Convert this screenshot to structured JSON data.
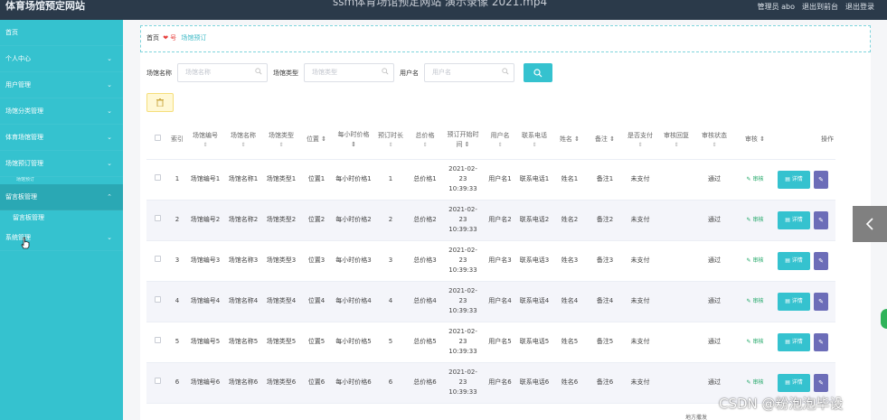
{
  "topbar": {
    "site_title": "体育场馆预定网站",
    "video_title": "ssm体育场馆预定网站 演示录像 2021.mp4",
    "admin_label": "管理员 abo",
    "exit_to_front": "退出到前台",
    "logout": "退出登录"
  },
  "sidebar": {
    "items": [
      {
        "label": "首页",
        "has_chevron": false
      },
      {
        "label": "个人中心",
        "has_chevron": true
      },
      {
        "label": "用户管理",
        "has_chevron": true
      },
      {
        "label": "场馆分类管理",
        "has_chevron": true
      },
      {
        "label": "体育场馆管理",
        "has_chevron": true
      },
      {
        "label": "场馆预订管理",
        "has_chevron": true
      }
    ],
    "partial_sub": "场馆预订",
    "active": {
      "label": "留言板管理"
    },
    "active_sub": "留言板管理",
    "after": {
      "label": "系统管理"
    }
  },
  "breadcrumb": {
    "home": "首页",
    "heart": "❤",
    "sep": "号",
    "current": "场馆预订"
  },
  "search": {
    "venue_name_label": "场馆名称",
    "venue_name_placeholder": "场馆名称",
    "venue_type_label": "场馆类型",
    "venue_type_placeholder": "场馆类型",
    "user_label": "用户名",
    "user_placeholder": "用户名"
  },
  "table": {
    "headers": [
      "索引",
      "场馆编号",
      "场馆名称",
      "场馆类型",
      "位置",
      "每小时价格",
      "预订时长",
      "总价格",
      "预订开始时间",
      "用户名",
      "联系电话",
      "姓名",
      "备注",
      "是否支付",
      "审核回复",
      "审核状态",
      "审核",
      "操作"
    ],
    "sort_mark": "⇕",
    "rows": [
      {
        "index": "1",
        "venue_no": "场馆编号1",
        "venue_name": "场馆名称1",
        "venue_type": "场馆类型1",
        "location": "位置1",
        "price": "每小时价格1",
        "duration": "1",
        "total": "总价格1",
        "start_time": "2021-02-23 10:39:33",
        "user": "用户名1",
        "phone": "联系电话1",
        "name": "姓名1",
        "remark": "备注1",
        "paid": "未支付",
        "reply": "",
        "status": "通过",
        "audit": "审核",
        "detail": "详情"
      },
      {
        "index": "2",
        "venue_no": "场馆编号2",
        "venue_name": "场馆名称2",
        "venue_type": "场馆类型2",
        "location": "位置2",
        "price": "每小时价格2",
        "duration": "2",
        "total": "总价格2",
        "start_time": "2021-02-23 10:39:33",
        "user": "用户名2",
        "phone": "联系电话2",
        "name": "姓名2",
        "remark": "备注2",
        "paid": "未支付",
        "reply": "",
        "status": "通过",
        "audit": "审核",
        "detail": "详情"
      },
      {
        "index": "3",
        "venue_no": "场馆编号3",
        "venue_name": "场馆名称3",
        "venue_type": "场馆类型3",
        "location": "位置3",
        "price": "每小时价格3",
        "duration": "3",
        "total": "总价格3",
        "start_time": "2021-02-23 10:39:33",
        "user": "用户名3",
        "phone": "联系电话3",
        "name": "姓名3",
        "remark": "备注3",
        "paid": "未支付",
        "reply": "",
        "status": "通过",
        "audit": "审核",
        "detail": "详情"
      },
      {
        "index": "4",
        "venue_no": "场馆编号4",
        "venue_name": "场馆名称4",
        "venue_type": "场馆类型4",
        "location": "位置4",
        "price": "每小时价格4",
        "duration": "4",
        "total": "总价格4",
        "start_time": "2021-02-23 10:39:33",
        "user": "用户名4",
        "phone": "联系电话4",
        "name": "姓名4",
        "remark": "备注4",
        "paid": "未支付",
        "reply": "",
        "status": "通过",
        "audit": "审核",
        "detail": "详情"
      },
      {
        "index": "5",
        "venue_no": "场馆编号5",
        "venue_name": "场馆名称5",
        "venue_type": "场馆类型5",
        "location": "位置5",
        "price": "每小时价格5",
        "duration": "5",
        "total": "总价格5",
        "start_time": "2021-02-23 10:39:33",
        "user": "用户名5",
        "phone": "联系电话5",
        "name": "姓名5",
        "remark": "备注5",
        "paid": "未支付",
        "reply": "",
        "status": "通过",
        "audit": "审核",
        "detail": "详情"
      },
      {
        "index": "6",
        "venue_no": "场馆编号6",
        "venue_name": "场馆名称6",
        "venue_type": "场馆类型6",
        "location": "位置6",
        "price": "每小时价格6",
        "duration": "6",
        "total": "总价格6",
        "start_time": "2021-02-23 10:39:33",
        "user": "用户名6",
        "phone": "联系电话6",
        "name": "姓名6",
        "remark": "备注6",
        "paid": "未支付",
        "reply": "",
        "status": "通过",
        "audit": "审核",
        "detail": "详情"
      }
    ]
  },
  "partial_reply": "地方撒发",
  "watermark": "CSDN @粉泡泡毕设",
  "colors": {
    "sidebar": "#35c2cf",
    "topbar": "#2b3a4a",
    "accent": "#35c2cf",
    "edit": "#6c6db8",
    "audit": "#1aa563",
    "breadcrumb_heart": "#e7403d"
  },
  "icons": {
    "search": "magnifier-icon",
    "delete": "trash-icon",
    "audit": "pencil-icon",
    "detail": "document-icon",
    "edit": "edit-icon",
    "collapse": "chevron-left-icon"
  }
}
